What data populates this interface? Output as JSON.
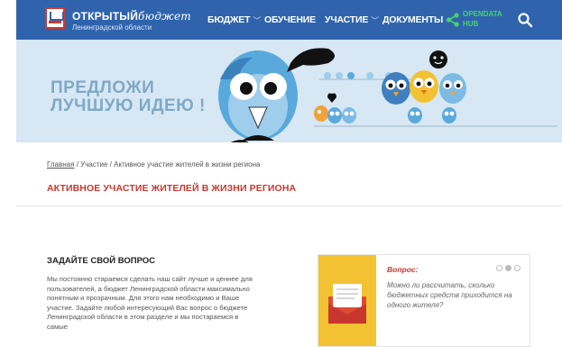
{
  "header": {
    "logo_title": "ОТКРЫТЫЙ",
    "logo_title_script": "бюджет",
    "logo_subtitle": "Ленинградской области",
    "nav": [
      {
        "label": "БЮДЖЕТ",
        "has_dropdown": true
      },
      {
        "label": "ОБУЧЕНИЕ",
        "has_dropdown": false
      },
      {
        "label": "УЧАСТИЕ",
        "has_dropdown": true
      },
      {
        "label": "ДОКУМЕНТЫ",
        "has_dropdown": false
      }
    ],
    "opendata_line1": "OPENDATA",
    "opendata_line2": "HUB",
    "search_icon": "search-icon"
  },
  "banner": {
    "line1": "ПРЕДЛОЖИ",
    "line2": "ЛУЧШУЮ ИДЕЮ !"
  },
  "breadcrumb": {
    "home": "Главная",
    "section": "Участие",
    "current": "Активное участие жителей в жизни региона",
    "separator": "/"
  },
  "page_title": "АКТИВНОЕ УЧАСТИЕ ЖИТЕЛЕЙ В ЖИЗНИ РЕГИОНА",
  "question_block": {
    "title": "ЗАДАЙТЕ СВОЙ ВОПРОС",
    "text": "Мы постоянно стараемся сделать наш сайт лучше и ценнее для пользователей, а бюджет Ленинградской области максимально понятным и прозрачным. Для этого нам необходимо и Ваше участие. Задайте любой интересующий Вас вопрос о бюджете Ленинградской области в этом разделе и мы постараемся в самые"
  },
  "card": {
    "label": "Вопрос:",
    "text": "Можно ли рассчитать, сколько бюджетных средств приходится на одного жителя?",
    "icon": "envelope-icon",
    "slides": 3,
    "active_slide": 2
  },
  "colors": {
    "header_bg": "#2f64ad",
    "accent_red": "#c8372d",
    "banner_bg": "#d7e8f4",
    "opendata_green": "#46d36a",
    "card_yellow": "#f2c232"
  }
}
